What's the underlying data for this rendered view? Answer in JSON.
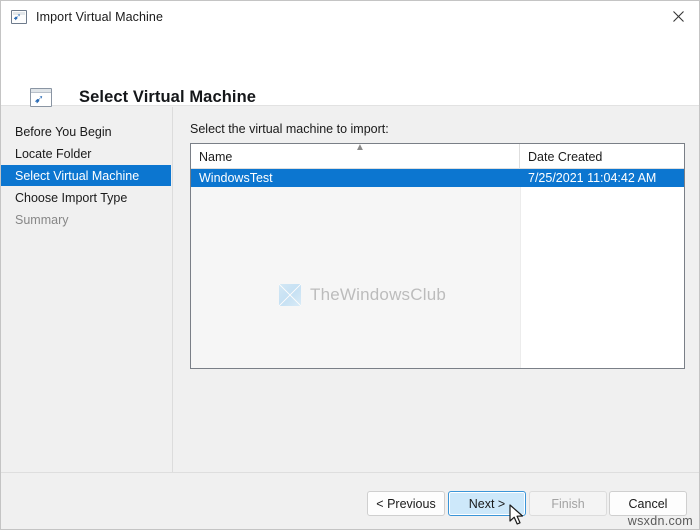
{
  "window": {
    "title": "Import Virtual Machine",
    "title_icon": "import-vm-icon",
    "close_icon": "close-icon"
  },
  "header": {
    "icon": "import-vm-large-icon",
    "title": "Select Virtual Machine"
  },
  "sidebar": {
    "items": [
      {
        "label": "Before You Begin",
        "state": "normal"
      },
      {
        "label": "Locate Folder",
        "state": "normal"
      },
      {
        "label": "Select Virtual Machine",
        "state": "selected"
      },
      {
        "label": "Choose Import Type",
        "state": "normal"
      },
      {
        "label": "Summary",
        "state": "disabled"
      }
    ]
  },
  "content": {
    "instruction": "Select the virtual machine to import:",
    "listview": {
      "columns": [
        {
          "key": "name",
          "label": "Name",
          "sorted": "ascending",
          "sort_icon": "chevron-up-icon"
        },
        {
          "key": "date",
          "label": "Date Created",
          "sorted": "none"
        }
      ],
      "rows": [
        {
          "name": "WindowsTest",
          "date": "7/25/2021 11:04:42 AM",
          "selected": true
        }
      ]
    },
    "watermark": {
      "text": "TheWindowsClub",
      "logo": "thewindowsclub-logo"
    }
  },
  "footer": {
    "buttons": [
      {
        "id": "previous",
        "label": "< Previous",
        "state": "normal"
      },
      {
        "id": "next",
        "label": "Next >",
        "state": "focused"
      },
      {
        "id": "finish",
        "label": "Finish",
        "state": "disabled"
      },
      {
        "id": "cancel",
        "label": "Cancel",
        "state": "normal"
      }
    ]
  },
  "overlay": {
    "corner_watermark": "wsxdn.com",
    "cursor": "arrow-cursor"
  },
  "colors": {
    "accent": "#0c76d0",
    "focus_button_bg": "#cde8fa",
    "focus_button_border": "#3a95d8",
    "dialog_bg": "#f0f0f0",
    "panel_bg": "#ffffff",
    "disabled_text": "#878787"
  }
}
